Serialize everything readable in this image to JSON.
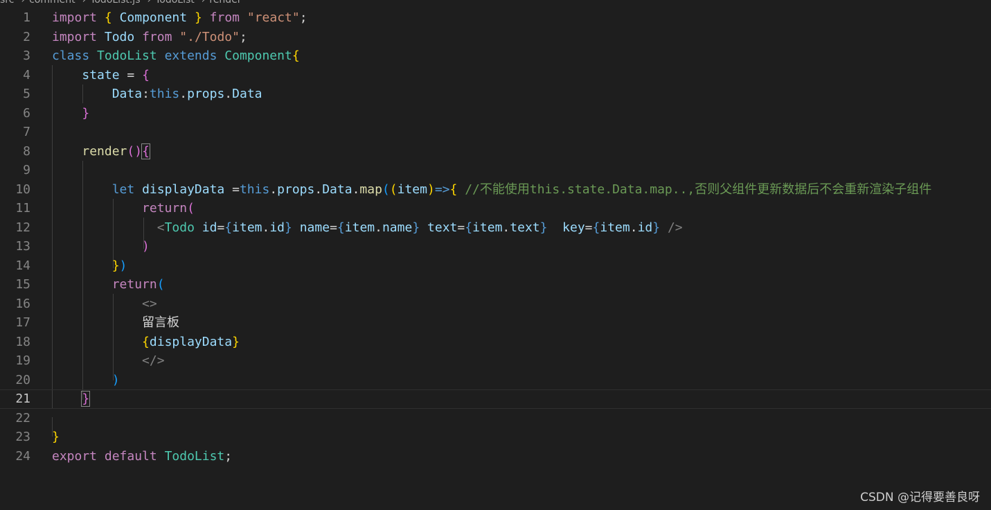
{
  "breadcrumb": {
    "items": [
      "src",
      "comment",
      "TodoList.js",
      "TodoList",
      "render"
    ]
  },
  "editor": {
    "current_line": 21,
    "lines": [
      {
        "n": "1"
      },
      {
        "n": "2"
      },
      {
        "n": "3"
      },
      {
        "n": "4"
      },
      {
        "n": "5"
      },
      {
        "n": "6"
      },
      {
        "n": "7"
      },
      {
        "n": "8"
      },
      {
        "n": "9"
      },
      {
        "n": "10"
      },
      {
        "n": "11"
      },
      {
        "n": "12"
      },
      {
        "n": "13"
      },
      {
        "n": "14"
      },
      {
        "n": "15"
      },
      {
        "n": "16"
      },
      {
        "n": "17"
      },
      {
        "n": "18"
      },
      {
        "n": "19"
      },
      {
        "n": "20"
      },
      {
        "n": "21"
      },
      {
        "n": "22"
      },
      {
        "n": "23"
      },
      {
        "n": "24"
      }
    ],
    "tokens": {
      "import": "import",
      "from": "from",
      "component": "Component",
      "react_str": "\"react\"",
      "todo": "Todo",
      "todo_path": "\"./Todo\"",
      "class": "class",
      "todolist": "TodoList",
      "extends": "extends",
      "state": "state",
      "data_key": "Data",
      "this": "this",
      "props": "props",
      "render": "render",
      "let": "let",
      "displayData": "displayData",
      "map": "map",
      "item": "item",
      "comment": "//不能使用this.state.Data.map..,否则父组件更新数据后不会重新渲染子组件",
      "return": "return",
      "id": "id",
      "name": "name",
      "text": "text",
      "key": "key",
      "chinese_text": "留言板",
      "export": "export",
      "default": "default"
    }
  },
  "watermark": "CSDN @记得要善良呀",
  "colors": {
    "background": "#1e1e1e",
    "keyword_control": "#c586c0",
    "keyword": "#569cd6",
    "type": "#4ec9b0",
    "variable": "#9cdcfe",
    "function": "#dcdcaa",
    "string": "#ce9178",
    "comment": "#6a9955"
  }
}
